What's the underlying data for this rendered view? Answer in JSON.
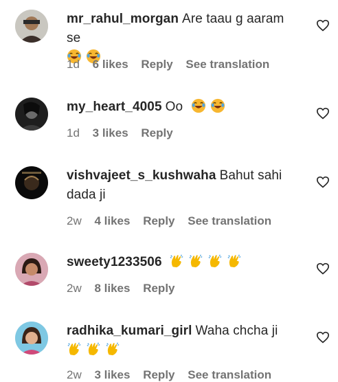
{
  "comments": [
    {
      "username": "mr_rahul_morgan",
      "text": "Are taau g aaram se",
      "emojis": [
        "laughing-tears-emoji",
        "laughing-tears-emoji"
      ],
      "time": "1d",
      "likes": "6 likes",
      "reply": "Reply",
      "translation": "See translation"
    },
    {
      "username": "my_heart_4005",
      "text": "Oo",
      "emojis": [
        "laughing-tears-emoji",
        "laughing-tears-emoji"
      ],
      "time": "1d",
      "likes": "3 likes",
      "reply": "Reply",
      "translation": ""
    },
    {
      "username": "vishvajeet_s_kushwaha",
      "text": "Bahut sahi dada ji",
      "emojis": [],
      "time": "2w",
      "likes": "4 likes",
      "reply": "Reply",
      "translation": "See translation"
    },
    {
      "username": "sweety1233506",
      "text": "",
      "emojis": [
        "clapping-hands-emoji",
        "clapping-hands-emoji",
        "clapping-hands-emoji",
        "clapping-hands-emoji"
      ],
      "time": "2w",
      "likes": "8 likes",
      "reply": "Reply",
      "translation": ""
    },
    {
      "username": "radhika_kumari_girl",
      "text": "Waha chcha ji",
      "emojis": [
        "clapping-hands-emoji",
        "clapping-hands-emoji",
        "clapping-hands-emoji"
      ],
      "time": "2w",
      "likes": "3 likes",
      "reply": "Reply",
      "translation": "See translation"
    }
  ],
  "colors": {
    "text": "#262626",
    "secondary": "#737373",
    "emoji": "#f7b731"
  }
}
